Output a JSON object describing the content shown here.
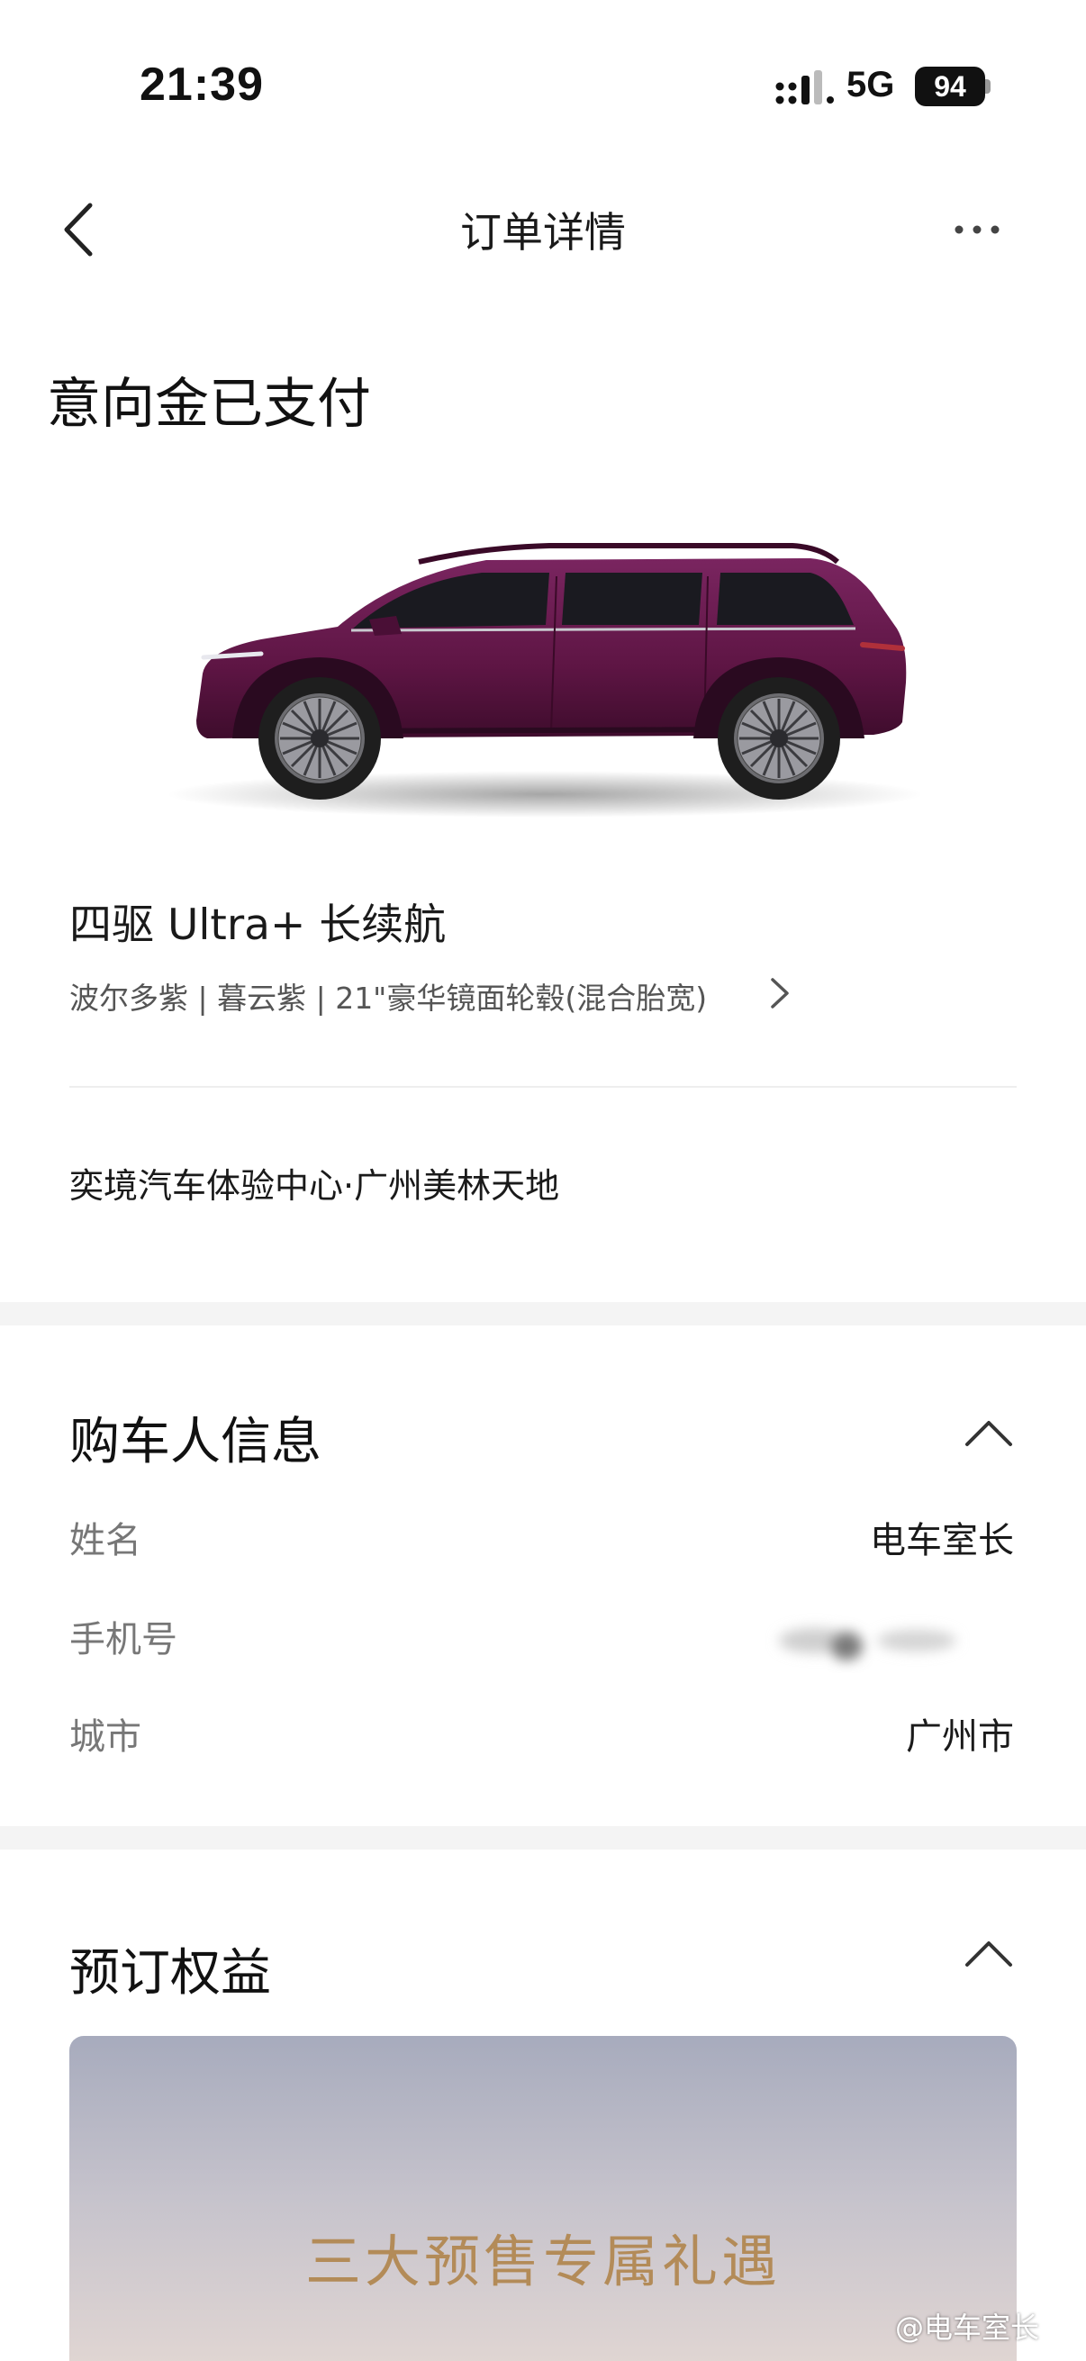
{
  "status_bar": {
    "time": "21:39",
    "network": "5G",
    "battery": "94"
  },
  "nav": {
    "title": "订单详情",
    "back_icon": "chevron-left-icon",
    "more_icon": "more-horizontal-icon"
  },
  "order": {
    "status": "意向金已支付",
    "car_color": "#5e1544",
    "model": "四驱 Ultra+ 长续航",
    "config": "波尔多紫 | 暮云紫 | 21\"豪华镜面轮毂(混合胎宽)",
    "store": "奕境汽车体验中心·广州美林天地"
  },
  "buyer": {
    "title": "购车人信息",
    "fields": [
      {
        "label": "姓名",
        "value": "电车室长"
      },
      {
        "label": "手机号",
        "value": ""
      },
      {
        "label": "城市",
        "value": "广州市"
      }
    ]
  },
  "benefits": {
    "title": "预订权益",
    "banner_text": "三大预售专属礼遇"
  },
  "watermark": "@电车室长",
  "colors": {
    "banner_text": "#b38b58",
    "page_bg": "#f4f4f4"
  }
}
